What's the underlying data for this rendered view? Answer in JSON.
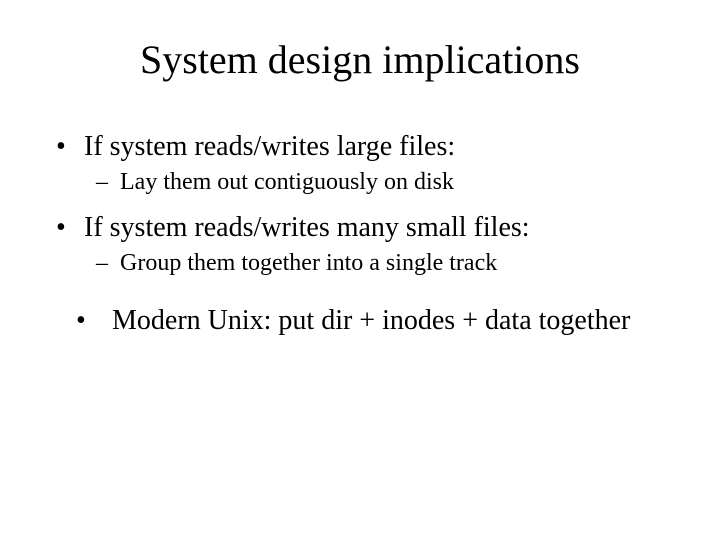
{
  "slide": {
    "title": "System design implications",
    "bullets": [
      {
        "level": 1,
        "text": "If system reads/writes large files:"
      },
      {
        "level": 2,
        "text": "Lay them out contiguously on disk"
      },
      {
        "level": 1,
        "text": "If system reads/writes many small files:"
      },
      {
        "level": 2,
        "text": "Group them together into a single track"
      },
      {
        "level": 1,
        "indent": true,
        "text": "Modern Unix: put dir + inodes + data together"
      }
    ]
  }
}
